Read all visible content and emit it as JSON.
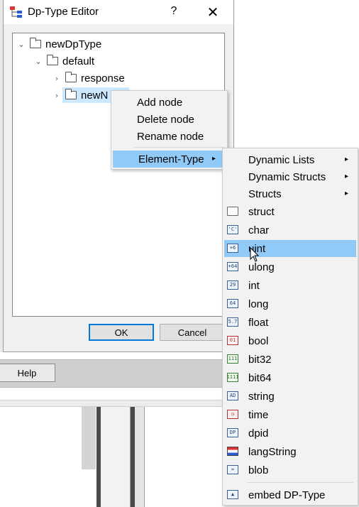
{
  "background": {
    "help_label": "Help"
  },
  "dialog": {
    "title": "Dp-Type Editor",
    "help_glyph": "?",
    "close_glyph": "✕",
    "ok_label": "OK",
    "cancel_label": "Cancel",
    "tree": [
      {
        "label": "newDpType",
        "chevron": "⌄"
      },
      {
        "label": "default",
        "chevron": "⌄"
      },
      {
        "label": "response",
        "chevron": "›"
      },
      {
        "label": "newN",
        "chevron": "›",
        "selected": true
      }
    ]
  },
  "context_menu": {
    "items": [
      "Add node",
      "Delete node",
      "Rename node"
    ],
    "element_type_label": "Element-Type",
    "arrow": "▸"
  },
  "element_type_menu": {
    "submenus": [
      "Dynamic Lists",
      "Dynamic Structs",
      "Structs"
    ],
    "types": [
      {
        "label": "struct",
        "icon": "folder-icon",
        "glyph": ""
      },
      {
        "label": "char",
        "icon": "char-icon",
        "glyph": "'C'"
      },
      {
        "label": "uint",
        "icon": "uint-icon",
        "glyph": "+6",
        "highlighted": true
      },
      {
        "label": "ulong",
        "icon": "ulong-icon",
        "glyph": "+64"
      },
      {
        "label": "int",
        "icon": "int-icon",
        "glyph": "29"
      },
      {
        "label": "long",
        "icon": "long-icon",
        "glyph": "64"
      },
      {
        "label": "float",
        "icon": "float-icon",
        "glyph": "5.7"
      },
      {
        "label": "bool",
        "icon": "bool-icon",
        "glyph": "01"
      },
      {
        "label": "bit32",
        "icon": "bit32-icon",
        "glyph": "111"
      },
      {
        "label": "bit64",
        "icon": "bit64-icon",
        "glyph": "1111"
      },
      {
        "label": "string",
        "icon": "string-icon",
        "glyph": "AD"
      },
      {
        "label": "time",
        "icon": "clock-icon",
        "glyph": "◷"
      },
      {
        "label": "dpid",
        "icon": "dpid-icon",
        "glyph": "DP"
      },
      {
        "label": "langString",
        "icon": "flag-icon",
        "glyph": ""
      },
      {
        "label": "blob",
        "icon": "blob-icon",
        "glyph": "≈"
      }
    ],
    "embed_label": "embed DP-Type",
    "embed_glyph": "▲"
  },
  "colors": {
    "highlight": "#91c9f7",
    "selection": "#cce8ff",
    "default_button_border": "#0078d7"
  }
}
